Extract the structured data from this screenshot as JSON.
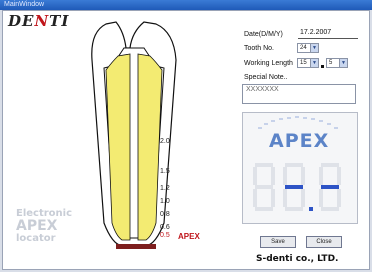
{
  "window": {
    "title": "MainWindow"
  },
  "logo": {
    "text_left": "DE",
    "text_slash": "N",
    "text_right": "TI"
  },
  "watermark": {
    "line1": "Electronic",
    "line2": "APEX",
    "line3": "locator"
  },
  "tooth": {
    "scale_labels": [
      "2.0",
      "1.5",
      "1.2",
      "1.0",
      "0.8",
      "0.6",
      "0.5"
    ],
    "apex_label": "APEX"
  },
  "form": {
    "date_label": "Date(D/M/Y)",
    "date_value": "17.2.2007",
    "tooth_label": "Tooth No.",
    "tooth_value": "24",
    "working_length_label": "Working Length",
    "wl_value_1": "15",
    "wl_value_2": "5",
    "special_note_label": "Special Note..",
    "special_note_value": "XXXXXXX"
  },
  "display": {
    "title": "APEX",
    "readout": "88.8",
    "colors": {
      "title": "#5c84c8",
      "dim_segment": "#dfe2e8",
      "lit_segment": "#2e54c6"
    }
  },
  "buttons": {
    "save": "Save",
    "close": "Close"
  },
  "brand": "S-denti co., LTD."
}
